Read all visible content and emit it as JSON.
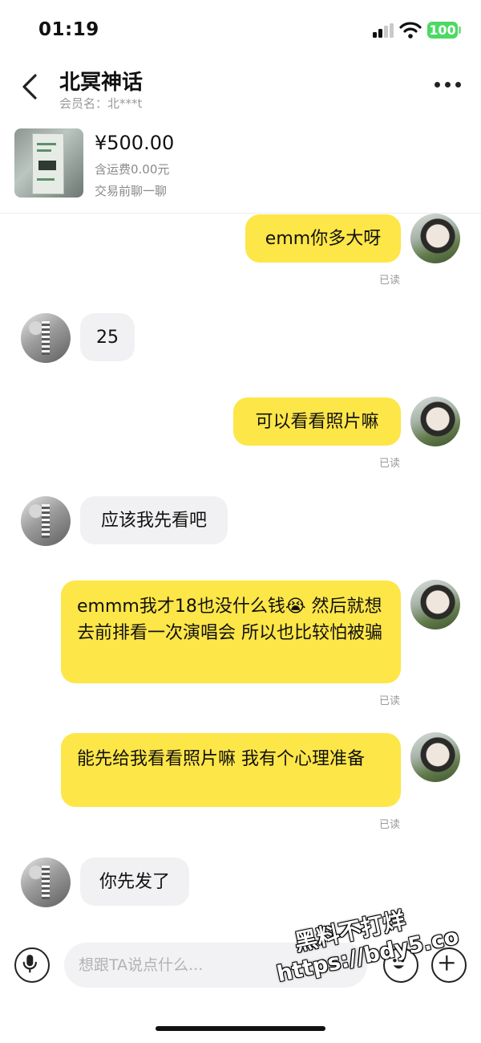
{
  "status_bar": {
    "time": "01:19",
    "battery": "100",
    "battery_color": "#4cd964"
  },
  "header": {
    "title": "北冥神话",
    "member_label": "会员名：",
    "member_value": "北***t"
  },
  "product": {
    "price": "¥500.00",
    "shipping": "含运费0.00元",
    "hint": "交易前聊一聊"
  },
  "messages": [
    {
      "side": "mine",
      "text": "emm你多大呀",
      "read": "已读"
    },
    {
      "side": "theirs",
      "text": "25"
    },
    {
      "side": "mine",
      "text": "可以看看照片嘛",
      "read": "已读"
    },
    {
      "side": "theirs",
      "text": "应该我先看吧"
    },
    {
      "side": "mine",
      "text": "emmm我才18也没什么钱😭  然后就想去前排看一次演唱会  所以也比较怕被骗",
      "read": "已读"
    },
    {
      "side": "mine",
      "text": "能先给我看看照片嘛  我有个心理准备",
      "read": "已读"
    },
    {
      "side": "theirs",
      "text": "你先发了"
    }
  ],
  "input": {
    "placeholder": "想跟TA说点什么..."
  },
  "watermark": {
    "line1": "黑料不打烊",
    "line2": "https://bdy5.co"
  },
  "colors": {
    "my_bubble": "#fde647",
    "their_bubble": "#f1f1f3",
    "read_text": "#9a9a9a"
  },
  "icons": {
    "back": "chevron-left-icon",
    "more": "more-dots-icon",
    "voice": "microphone-icon",
    "emoji": "smiley-icon",
    "plus": "plus-icon",
    "signal": "signal-icon",
    "wifi": "wifi-icon"
  }
}
